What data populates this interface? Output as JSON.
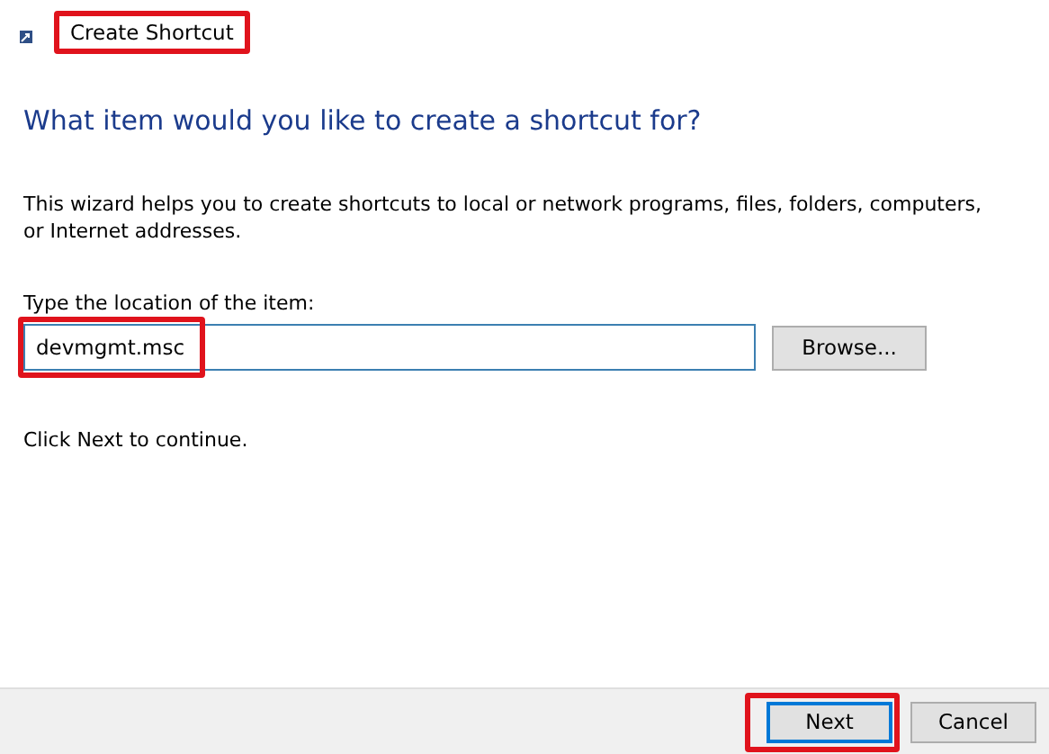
{
  "window": {
    "title": "Create Shortcut",
    "highlighted": true
  },
  "heading": "What item would you like to create a shortcut for?",
  "description": "This wizard helps you to create shortcuts to local or network programs, files, folders, computers, or Internet addresses.",
  "location": {
    "label": "Type the location of the item:",
    "value": "devmgmt.msc",
    "highlighted": true
  },
  "browse_button": "Browse...",
  "hint": "Click Next to continue.",
  "buttons": [
    {
      "label": "Next",
      "default": true,
      "highlighted": true
    },
    {
      "label": "Cancel",
      "default": false,
      "highlighted": false
    }
  ]
}
